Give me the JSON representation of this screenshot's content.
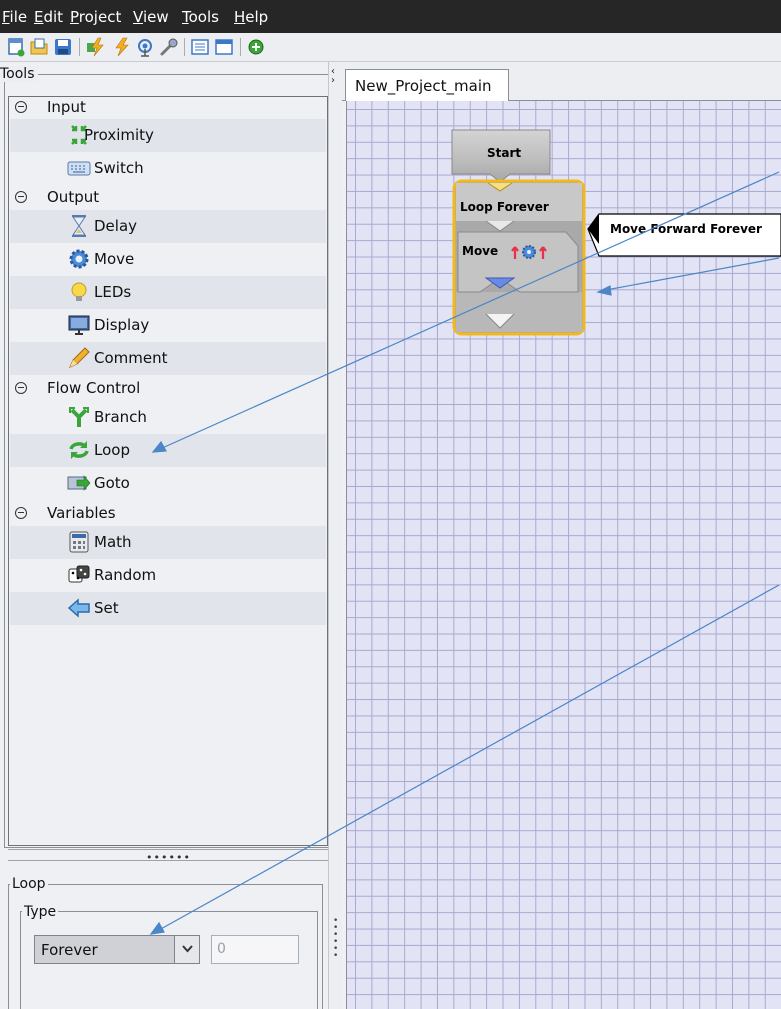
{
  "menubar": {
    "items": [
      {
        "label": "File",
        "accel": "F",
        "rest": "ile"
      },
      {
        "label": "Edit",
        "accel": "E",
        "rest": "dit"
      },
      {
        "label": "Project",
        "accel": "P",
        "rest": "roject"
      },
      {
        "label": "View",
        "accel": "V",
        "rest": "iew"
      },
      {
        "label": "Tools",
        "accel": "T",
        "rest": "ools"
      },
      {
        "label": "Help",
        "accel": "H",
        "rest": "elp"
      }
    ]
  },
  "toolbar": {
    "buttons": [
      "new-project-icon",
      "open-folder-icon",
      "save-icon",
      "compile-icon",
      "download-icon",
      "connect-icon",
      "settings-wrench-icon",
      "list-view-icon",
      "window-icon",
      "add-icon"
    ]
  },
  "tools_panel": {
    "title": "Tools",
    "categories": [
      {
        "label": "Input",
        "items": [
          {
            "label": "Proximity",
            "icon": "proximity-arrows-icon"
          },
          {
            "label": "Switch",
            "icon": "keyboard-icon"
          }
        ]
      },
      {
        "label": "Output",
        "items": [
          {
            "label": "Delay",
            "icon": "hourglass-icon"
          },
          {
            "label": "Move",
            "icon": "gear-icon"
          },
          {
            "label": "LEDs",
            "icon": "lightbulb-icon"
          },
          {
            "label": "Display",
            "icon": "monitor-icon"
          },
          {
            "label": "Comment",
            "icon": "pencil-icon"
          }
        ]
      },
      {
        "label": "Flow Control",
        "items": [
          {
            "label": "Branch",
            "icon": "branch-icon"
          },
          {
            "label": "Loop",
            "icon": "loop-arrows-icon"
          },
          {
            "label": "Goto",
            "icon": "goto-icon"
          }
        ]
      },
      {
        "label": "Variables",
        "items": [
          {
            "label": "Math",
            "icon": "calculator-icon"
          },
          {
            "label": "Random",
            "icon": "dice-icon"
          },
          {
            "label": "Set",
            "icon": "left-arrow-icon"
          }
        ]
      }
    ]
  },
  "properties": {
    "title": "Loop",
    "type_group_title": "Type",
    "type_value": "Forever",
    "count_value": "0"
  },
  "splitter": {
    "dots": "••••••"
  },
  "editor": {
    "tab_label": "New_Project_main",
    "blocks": {
      "start_label": "Start",
      "loop_label": "Loop Forever",
      "move_label": "Move",
      "comment_text": "Move Forward Forever"
    }
  },
  "colors": {
    "menubar_bg": "#262626",
    "canvas_bg": "#e3e3f6",
    "grid_line": "#a9a9cf",
    "loop_border": "#f2b81c",
    "annotation_arrow": "#4a86c8"
  }
}
